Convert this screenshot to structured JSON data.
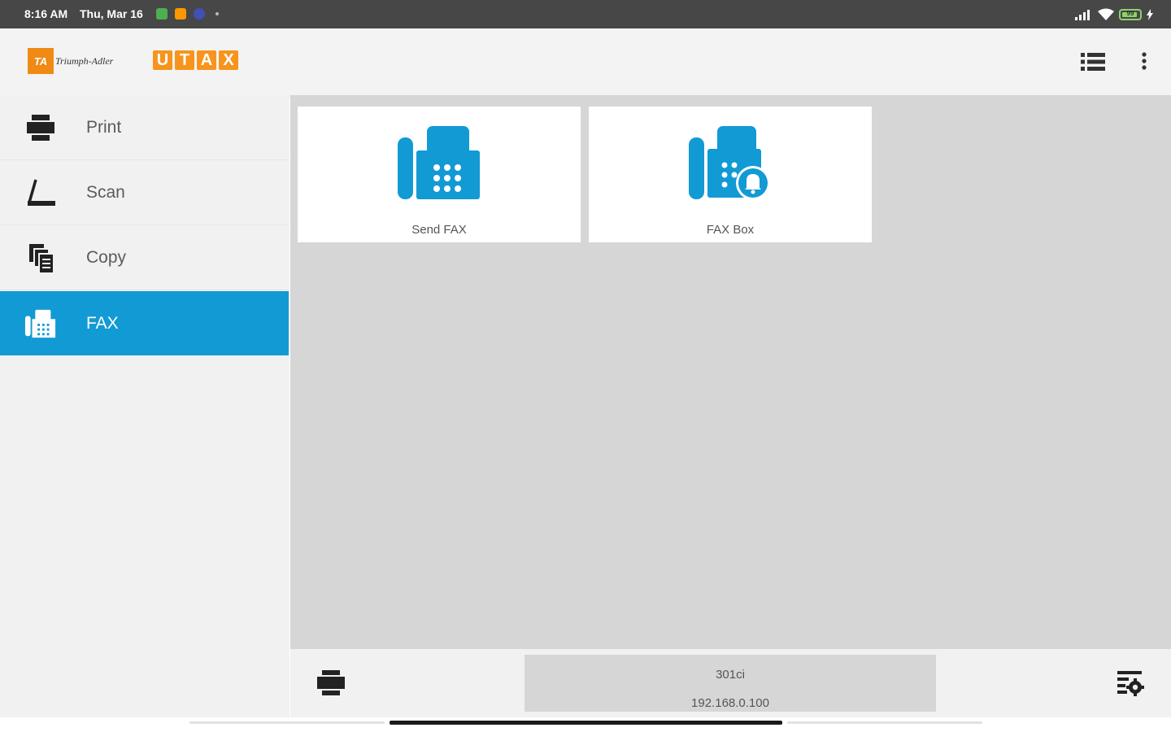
{
  "status_bar": {
    "time": "8:16 AM",
    "date": "Thu, Mar 16",
    "battery_percent": "99",
    "icons": [
      "notification-app-icon",
      "notification-app-icon",
      "notification-app-icon",
      "signal-icon",
      "wifi-icon",
      "battery-icon",
      "charging-icon"
    ]
  },
  "app_bar": {
    "brand_primary": "Triumph-Adler",
    "brand_primary_mark": "TA",
    "brand_secondary_letters": [
      "U",
      "T",
      "A",
      "X"
    ],
    "actions": [
      "list-view-icon",
      "more-vert-icon"
    ]
  },
  "sidebar": {
    "items": [
      {
        "label": "Print",
        "icon": "printer-icon",
        "active": false
      },
      {
        "label": "Scan",
        "icon": "scanner-icon",
        "active": false
      },
      {
        "label": "Copy",
        "icon": "copy-icon",
        "active": false
      },
      {
        "label": "FAX",
        "icon": "fax-icon",
        "active": true
      }
    ]
  },
  "main": {
    "tiles": [
      {
        "label": "Send FAX",
        "icon": "fax-machine-icon"
      },
      {
        "label": "FAX Box",
        "icon": "fax-box-bell-icon"
      }
    ]
  },
  "bottom_bar": {
    "device_name": "301ci",
    "device_ip": "192.168.0.100"
  },
  "colors": {
    "accent": "#129ad4",
    "status_bar": "#474747",
    "app_bar": "#f3f3f3",
    "sidebar": "#f1f1f1",
    "content": "#d6d6d6",
    "brand_orange": "#f7941d"
  }
}
